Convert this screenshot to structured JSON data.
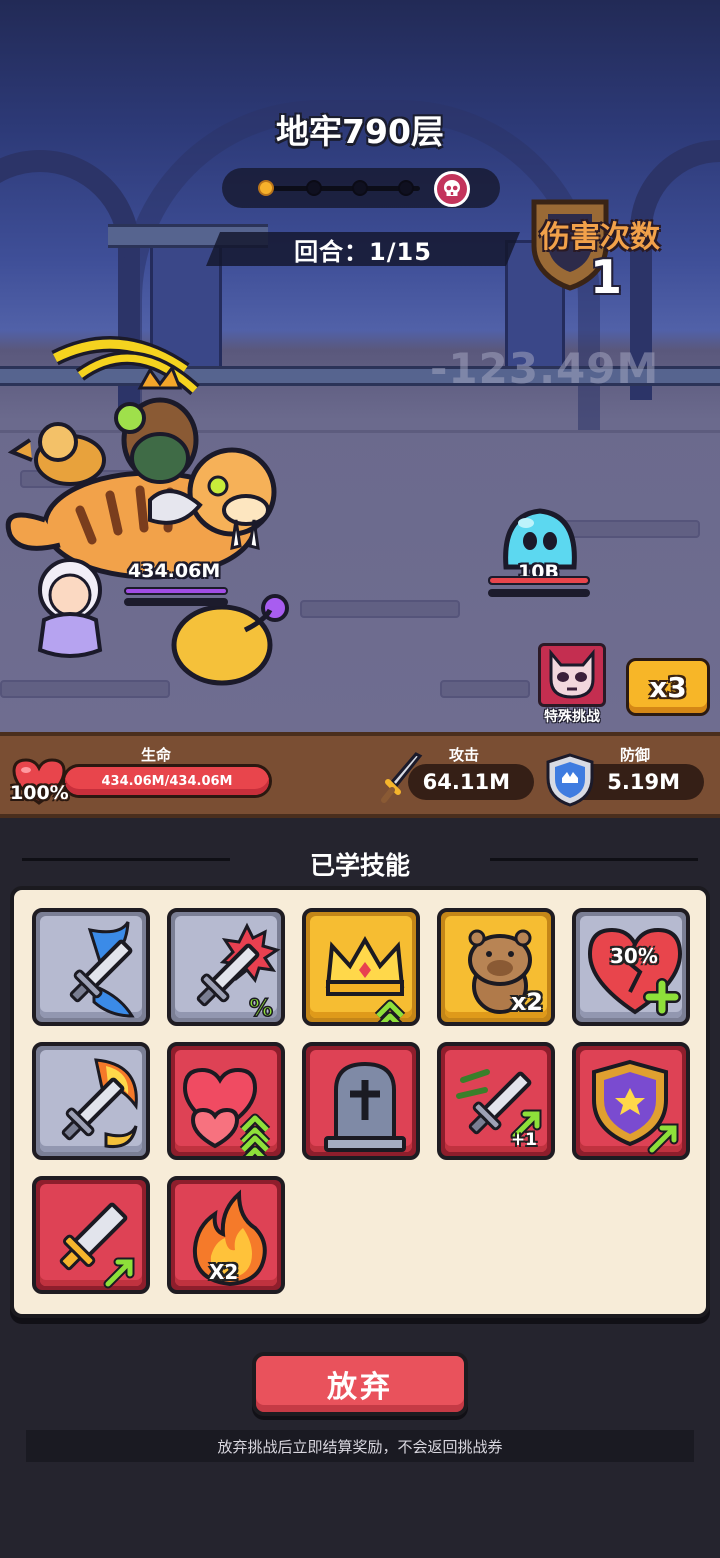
{
  "header": {
    "title": "地牢790层",
    "round": "回合：1/15",
    "stage_progress": {
      "current": 1,
      "total": 5
    }
  },
  "battle": {
    "damage_label": "伤害次数",
    "damage_count": "1",
    "floating_damage": "-123.49M",
    "hero_hp_label": "434.06M",
    "enemy_hp_label": "10B",
    "special_challenge_label": "特殊挑战",
    "speed_label": "x3"
  },
  "stats": {
    "hp_label": "生命",
    "hp_percent": "100%",
    "hp_value": "434.06M/434.06M",
    "hp_fraction": 1.0,
    "attack_label": "攻击",
    "attack_value": "64.11M",
    "defense_label": "防御",
    "defense_value": "5.19M"
  },
  "skills": {
    "title": "已学技能",
    "items": [
      {
        "icon": "sword-wave-icon",
        "style": "gray",
        "tag": ""
      },
      {
        "icon": "sword-crit-percent-icon",
        "style": "gray",
        "tag": ""
      },
      {
        "icon": "crown-upgrade-icon",
        "style": "gold",
        "tag": ""
      },
      {
        "icon": "capybara-double-icon",
        "style": "gold",
        "tag": "x2"
      },
      {
        "icon": "broken-heart-heal-icon",
        "style": "gray",
        "tag": "30%"
      },
      {
        "icon": "sword-fire-slash-icon",
        "style": "gray",
        "tag": ""
      },
      {
        "icon": "hearts-upgrade-icon",
        "style": "red",
        "tag": ""
      },
      {
        "icon": "tombstone-icon",
        "style": "red",
        "tag": ""
      },
      {
        "icon": "sword-extra-strike-icon",
        "style": "red",
        "tag": "+1"
      },
      {
        "icon": "shield-boost-icon",
        "style": "red",
        "tag": ""
      },
      {
        "icon": "sword-attack-up-icon",
        "style": "red",
        "tag": ""
      },
      {
        "icon": "flame-double-icon",
        "style": "red",
        "tag": "X2"
      }
    ]
  },
  "actions": {
    "give_up": "放弃",
    "note": "放弃挑战后立即结算奖励，不会返回挑战券"
  },
  "colors": {
    "hp_red": "#e8454c",
    "gold": "#f6bd32",
    "skill_red": "#de4255",
    "skill_gray": "#b6bad0",
    "damage_orange": "#f2a14a"
  }
}
